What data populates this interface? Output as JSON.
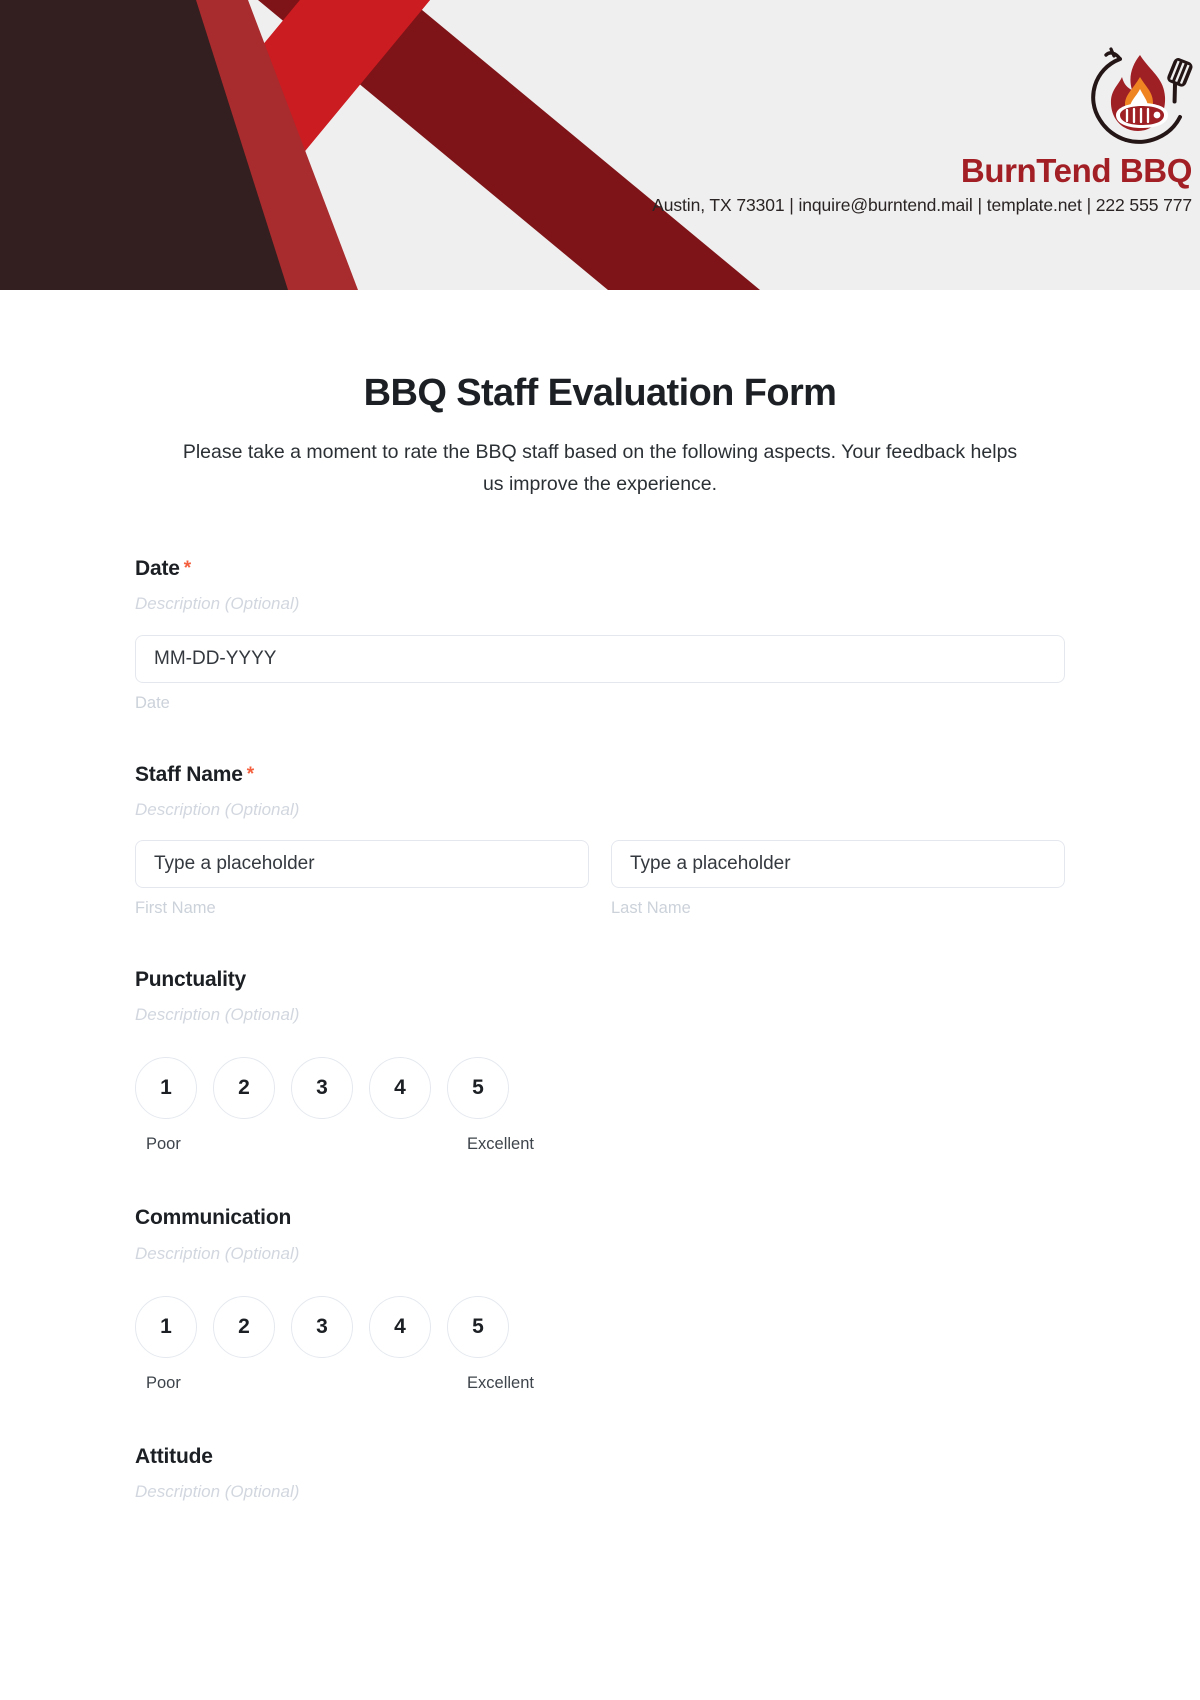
{
  "header": {
    "brand_name": "BurnTend BBQ",
    "contact_line": "Austin, TX 73301 | inquire@burntend.mail | template.net | 222 555 777",
    "logo_icon": "bbq-flame-grill-logo",
    "colors": {
      "banner_background": "#f0efef",
      "dark_maroon": "#331f1f",
      "bright_red": "#cb1c21",
      "mid_red": "#a82b2e",
      "deep_red": "#7e1418",
      "brand_text": "#a22025"
    }
  },
  "form": {
    "title": "BBQ Staff Evaluation Form",
    "subtitle": "Please take a moment to rate the BBQ staff based on the following aspects. Your feedback helps us improve the experience.",
    "required_marker": "*",
    "description_placeholder": "Description (Optional)",
    "fields": [
      {
        "key": "date",
        "label": "Date",
        "required": true,
        "description": "Description (Optional)",
        "inputs": [
          {
            "value": "MM-DD-YYYY",
            "placeholder": "MM-DD-YYYY",
            "sub_label": "Date"
          }
        ]
      },
      {
        "key": "staff_name",
        "label": "Staff Name",
        "required": true,
        "description": "Description (Optional)",
        "inputs": [
          {
            "value": "Type a placeholder",
            "placeholder": "Type a placeholder",
            "sub_label": "First Name"
          },
          {
            "value": "Type a placeholder",
            "placeholder": "Type a placeholder",
            "sub_label": "Last Name"
          }
        ]
      },
      {
        "key": "punctuality",
        "label": "Punctuality",
        "required": false,
        "description": "Description (Optional)",
        "rating": {
          "options": [
            "1",
            "2",
            "3",
            "4",
            "5"
          ],
          "low_anchor": "Poor",
          "high_anchor": "Excellent",
          "selected": null
        }
      },
      {
        "key": "communication",
        "label": "Communication",
        "required": false,
        "description": "Description (Optional)",
        "rating": {
          "options": [
            "1",
            "2",
            "3",
            "4",
            "5"
          ],
          "low_anchor": "Poor",
          "high_anchor": "Excellent",
          "selected": null
        }
      },
      {
        "key": "attitude",
        "label": "Attitude",
        "required": false,
        "description": "Description (Optional)"
      }
    ]
  }
}
